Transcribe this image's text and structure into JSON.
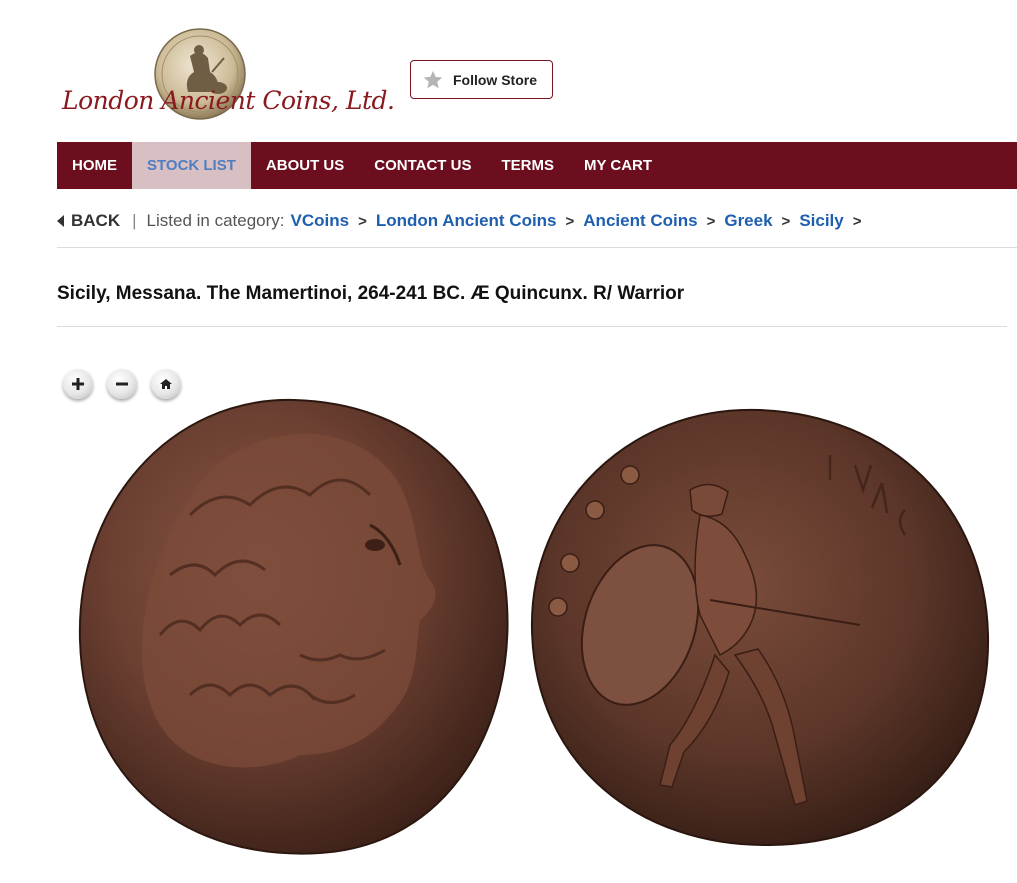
{
  "brand": {
    "logo_text": "London Ancient Coins, Ltd."
  },
  "follow": {
    "label": "Follow Store",
    "icon": "star-icon"
  },
  "nav": {
    "items": [
      {
        "label": "HOME"
      },
      {
        "label": "STOCK LIST",
        "active": true
      },
      {
        "label": "ABOUT US"
      },
      {
        "label": "CONTACT US"
      },
      {
        "label": "TERMS"
      },
      {
        "label": "MY CART"
      }
    ]
  },
  "breadcrumb": {
    "back": "BACK",
    "separator": "|",
    "listed": "Listed in category:",
    "links": [
      "VCoins",
      "London Ancient Coins",
      "Ancient Coins",
      "Greek",
      "Sicily"
    ],
    "arrow": ">"
  },
  "item": {
    "title": "Sicily, Messana. The Mamertinoi, 264-241 BC. Æ Quincunx. R/ Warrior"
  },
  "viewer": {
    "controls": [
      "zoom-in-icon",
      "zoom-out-icon",
      "home-icon"
    ]
  },
  "colors": {
    "nav_bg": "#6d0e1e",
    "nav_active_bg": "#d8bfc4",
    "link": "#1f5fb0",
    "brand": "#8a1a20"
  }
}
